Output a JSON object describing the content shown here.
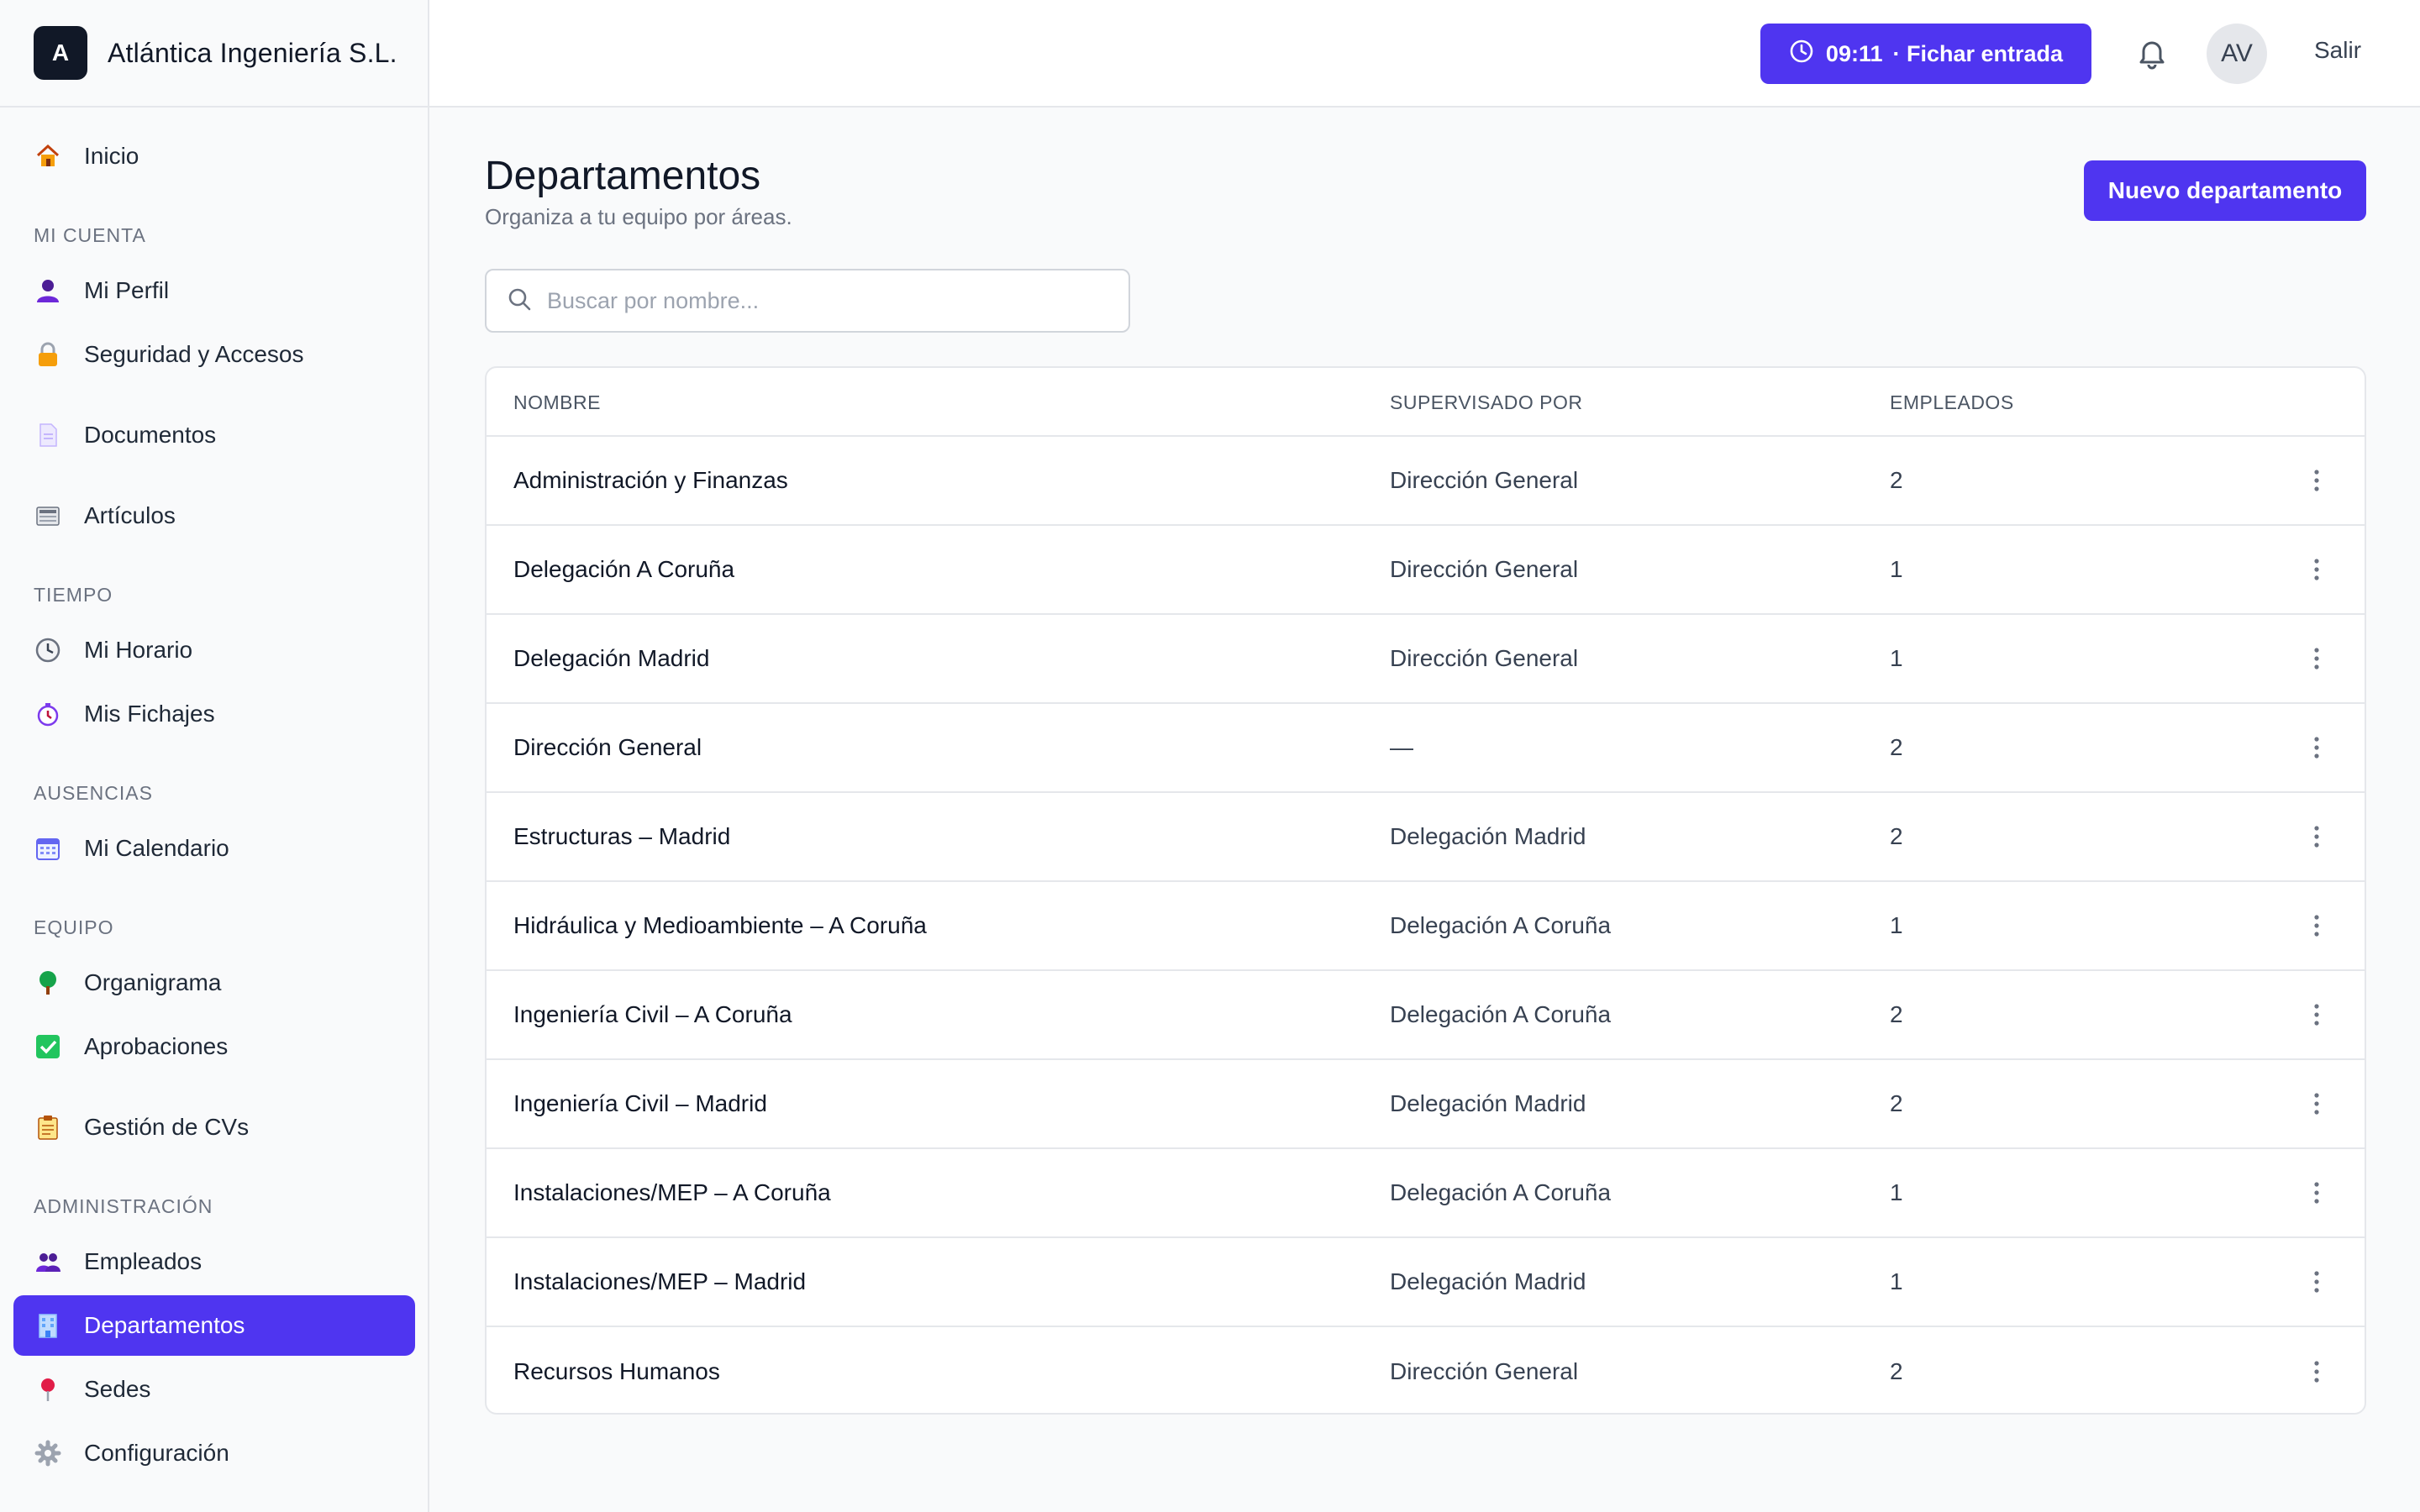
{
  "brand": {
    "logo_letter": "A",
    "name": "Atlántica Ingeniería S.L."
  },
  "sidebar": {
    "items": [
      {
        "label": "Inicio",
        "icon": "home-icon"
      },
      {
        "section": "MI CUENTA"
      },
      {
        "label": "Mi Perfil",
        "icon": "user-icon"
      },
      {
        "label": "Seguridad y Accesos",
        "icon": "lock-icon"
      },
      {
        "label": "Documentos",
        "icon": "document-icon"
      },
      {
        "label": "Artículos",
        "icon": "newspaper-icon"
      },
      {
        "section": "TIEMPO"
      },
      {
        "label": "Mi Horario",
        "icon": "clock-icon"
      },
      {
        "label": "Mis Fichajes",
        "icon": "stopwatch-icon"
      },
      {
        "section": "AUSENCIAS"
      },
      {
        "label": "Mi Calendario",
        "icon": "calendar-icon"
      },
      {
        "section": "EQUIPO"
      },
      {
        "label": "Organigrama",
        "icon": "tree-icon"
      },
      {
        "label": "Aprobaciones",
        "icon": "check-icon"
      },
      {
        "label": "Gestión de CVs",
        "icon": "clipboard-icon"
      },
      {
        "section": "ADMINISTRACIÓN"
      },
      {
        "label": "Empleados",
        "icon": "users-icon"
      },
      {
        "label": "Departamentos",
        "icon": "building-icon",
        "active": true
      },
      {
        "label": "Sedes",
        "icon": "pin-icon"
      },
      {
        "label": "Configuración",
        "icon": "gear-icon"
      }
    ]
  },
  "topbar": {
    "clock_time": "09:11",
    "clock_action": "· Fichar entrada",
    "avatar_initials": "AV",
    "logout_label": "Salir"
  },
  "main": {
    "title": "Departamentos",
    "subtitle": "Organiza a tu equipo por áreas.",
    "new_button": "Nuevo departamento",
    "search_placeholder": "Buscar por nombre..."
  },
  "table": {
    "columns": [
      "NOMBRE",
      "SUPERVISADO POR",
      "EMPLEADOS"
    ],
    "rows": [
      {
        "name": "Administración y Finanzas",
        "supervisor": "Dirección General",
        "employees": "2"
      },
      {
        "name": "Delegación A Coruña",
        "supervisor": "Dirección General",
        "employees": "1"
      },
      {
        "name": "Delegación Madrid",
        "supervisor": "Dirección General",
        "employees": "1"
      },
      {
        "name": "Dirección General",
        "supervisor": "—",
        "employees": "2"
      },
      {
        "name": "Estructuras – Madrid",
        "supervisor": "Delegación Madrid",
        "employees": "2"
      },
      {
        "name": "Hidráulica y Medioambiente – A Coruña",
        "supervisor": "Delegación A Coruña",
        "employees": "1"
      },
      {
        "name": "Ingeniería Civil – A Coruña",
        "supervisor": "Delegación A Coruña",
        "employees": "2"
      },
      {
        "name": "Ingeniería Civil – Madrid",
        "supervisor": "Delegación Madrid",
        "employees": "2"
      },
      {
        "name": "Instalaciones/MEP – A Coruña",
        "supervisor": "Delegación A Coruña",
        "employees": "1"
      },
      {
        "name": "Instalaciones/MEP – Madrid",
        "supervisor": "Delegación Madrid",
        "employees": "1"
      },
      {
        "name": "Recursos Humanos",
        "supervisor": "Dirección General",
        "employees": "2"
      }
    ]
  },
  "colors": {
    "accent": "#4f35f0",
    "text": "#111827",
    "muted": "#6b7280",
    "border": "#e5e7eb"
  }
}
